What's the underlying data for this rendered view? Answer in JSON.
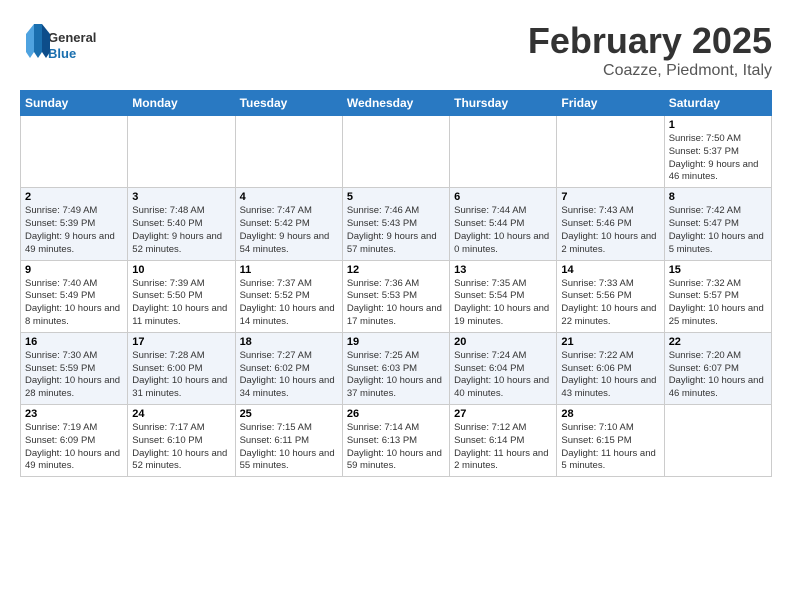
{
  "header": {
    "logo_general": "General",
    "logo_blue": "Blue",
    "month": "February 2025",
    "location": "Coazze, Piedmont, Italy"
  },
  "days_of_week": [
    "Sunday",
    "Monday",
    "Tuesday",
    "Wednesday",
    "Thursday",
    "Friday",
    "Saturday"
  ],
  "weeks": [
    [
      {
        "num": "",
        "info": ""
      },
      {
        "num": "",
        "info": ""
      },
      {
        "num": "",
        "info": ""
      },
      {
        "num": "",
        "info": ""
      },
      {
        "num": "",
        "info": ""
      },
      {
        "num": "",
        "info": ""
      },
      {
        "num": "1",
        "info": "Sunrise: 7:50 AM\nSunset: 5:37 PM\nDaylight: 9 hours and 46 minutes."
      }
    ],
    [
      {
        "num": "2",
        "info": "Sunrise: 7:49 AM\nSunset: 5:39 PM\nDaylight: 9 hours and 49 minutes."
      },
      {
        "num": "3",
        "info": "Sunrise: 7:48 AM\nSunset: 5:40 PM\nDaylight: 9 hours and 52 minutes."
      },
      {
        "num": "4",
        "info": "Sunrise: 7:47 AM\nSunset: 5:42 PM\nDaylight: 9 hours and 54 minutes."
      },
      {
        "num": "5",
        "info": "Sunrise: 7:46 AM\nSunset: 5:43 PM\nDaylight: 9 hours and 57 minutes."
      },
      {
        "num": "6",
        "info": "Sunrise: 7:44 AM\nSunset: 5:44 PM\nDaylight: 10 hours and 0 minutes."
      },
      {
        "num": "7",
        "info": "Sunrise: 7:43 AM\nSunset: 5:46 PM\nDaylight: 10 hours and 2 minutes."
      },
      {
        "num": "8",
        "info": "Sunrise: 7:42 AM\nSunset: 5:47 PM\nDaylight: 10 hours and 5 minutes."
      }
    ],
    [
      {
        "num": "9",
        "info": "Sunrise: 7:40 AM\nSunset: 5:49 PM\nDaylight: 10 hours and 8 minutes."
      },
      {
        "num": "10",
        "info": "Sunrise: 7:39 AM\nSunset: 5:50 PM\nDaylight: 10 hours and 11 minutes."
      },
      {
        "num": "11",
        "info": "Sunrise: 7:37 AM\nSunset: 5:52 PM\nDaylight: 10 hours and 14 minutes."
      },
      {
        "num": "12",
        "info": "Sunrise: 7:36 AM\nSunset: 5:53 PM\nDaylight: 10 hours and 17 minutes."
      },
      {
        "num": "13",
        "info": "Sunrise: 7:35 AM\nSunset: 5:54 PM\nDaylight: 10 hours and 19 minutes."
      },
      {
        "num": "14",
        "info": "Sunrise: 7:33 AM\nSunset: 5:56 PM\nDaylight: 10 hours and 22 minutes."
      },
      {
        "num": "15",
        "info": "Sunrise: 7:32 AM\nSunset: 5:57 PM\nDaylight: 10 hours and 25 minutes."
      }
    ],
    [
      {
        "num": "16",
        "info": "Sunrise: 7:30 AM\nSunset: 5:59 PM\nDaylight: 10 hours and 28 minutes."
      },
      {
        "num": "17",
        "info": "Sunrise: 7:28 AM\nSunset: 6:00 PM\nDaylight: 10 hours and 31 minutes."
      },
      {
        "num": "18",
        "info": "Sunrise: 7:27 AM\nSunset: 6:02 PM\nDaylight: 10 hours and 34 minutes."
      },
      {
        "num": "19",
        "info": "Sunrise: 7:25 AM\nSunset: 6:03 PM\nDaylight: 10 hours and 37 minutes."
      },
      {
        "num": "20",
        "info": "Sunrise: 7:24 AM\nSunset: 6:04 PM\nDaylight: 10 hours and 40 minutes."
      },
      {
        "num": "21",
        "info": "Sunrise: 7:22 AM\nSunset: 6:06 PM\nDaylight: 10 hours and 43 minutes."
      },
      {
        "num": "22",
        "info": "Sunrise: 7:20 AM\nSunset: 6:07 PM\nDaylight: 10 hours and 46 minutes."
      }
    ],
    [
      {
        "num": "23",
        "info": "Sunrise: 7:19 AM\nSunset: 6:09 PM\nDaylight: 10 hours and 49 minutes."
      },
      {
        "num": "24",
        "info": "Sunrise: 7:17 AM\nSunset: 6:10 PM\nDaylight: 10 hours and 52 minutes."
      },
      {
        "num": "25",
        "info": "Sunrise: 7:15 AM\nSunset: 6:11 PM\nDaylight: 10 hours and 55 minutes."
      },
      {
        "num": "26",
        "info": "Sunrise: 7:14 AM\nSunset: 6:13 PM\nDaylight: 10 hours and 59 minutes."
      },
      {
        "num": "27",
        "info": "Sunrise: 7:12 AM\nSunset: 6:14 PM\nDaylight: 11 hours and 2 minutes."
      },
      {
        "num": "28",
        "info": "Sunrise: 7:10 AM\nSunset: 6:15 PM\nDaylight: 11 hours and 5 minutes."
      },
      {
        "num": "",
        "info": ""
      }
    ]
  ]
}
